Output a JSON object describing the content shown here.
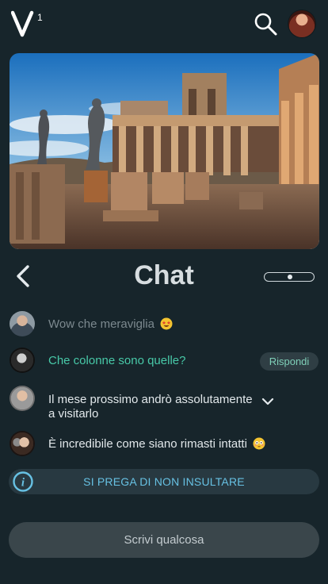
{
  "header": {
    "logo_text": "V",
    "logo_mark": "1",
    "search_icon": "search-icon",
    "avatar_icon": "user-avatar"
  },
  "hero": {
    "image_description": "ruins-with-columns-and-statues"
  },
  "chat": {
    "title": "Chat",
    "back_icon": "chevron-left-icon"
  },
  "messages": [
    {
      "text": "Wow che meraviglia",
      "emoji": "star-struck-emoji"
    },
    {
      "text": "Che colonne sono quelle?",
      "action": "Rispondi"
    },
    {
      "text": "Il mese prossimo andrò assolutamente a visitarlo",
      "icon": "chevron-down-icon"
    },
    {
      "text": "È incredibile come siano rimasti intatti",
      "emoji": "flushed-emoji"
    }
  ],
  "notice": {
    "text": "SI PREGA DI NON INSULTARE",
    "icon": "info-icon"
  },
  "composer": {
    "placeholder": "Scrivi qualcosa"
  },
  "colors": {
    "background": "#17252b",
    "accent_green": "#48c9a8",
    "accent_blue": "#67c1e3",
    "input_bg": "#3a464b"
  }
}
